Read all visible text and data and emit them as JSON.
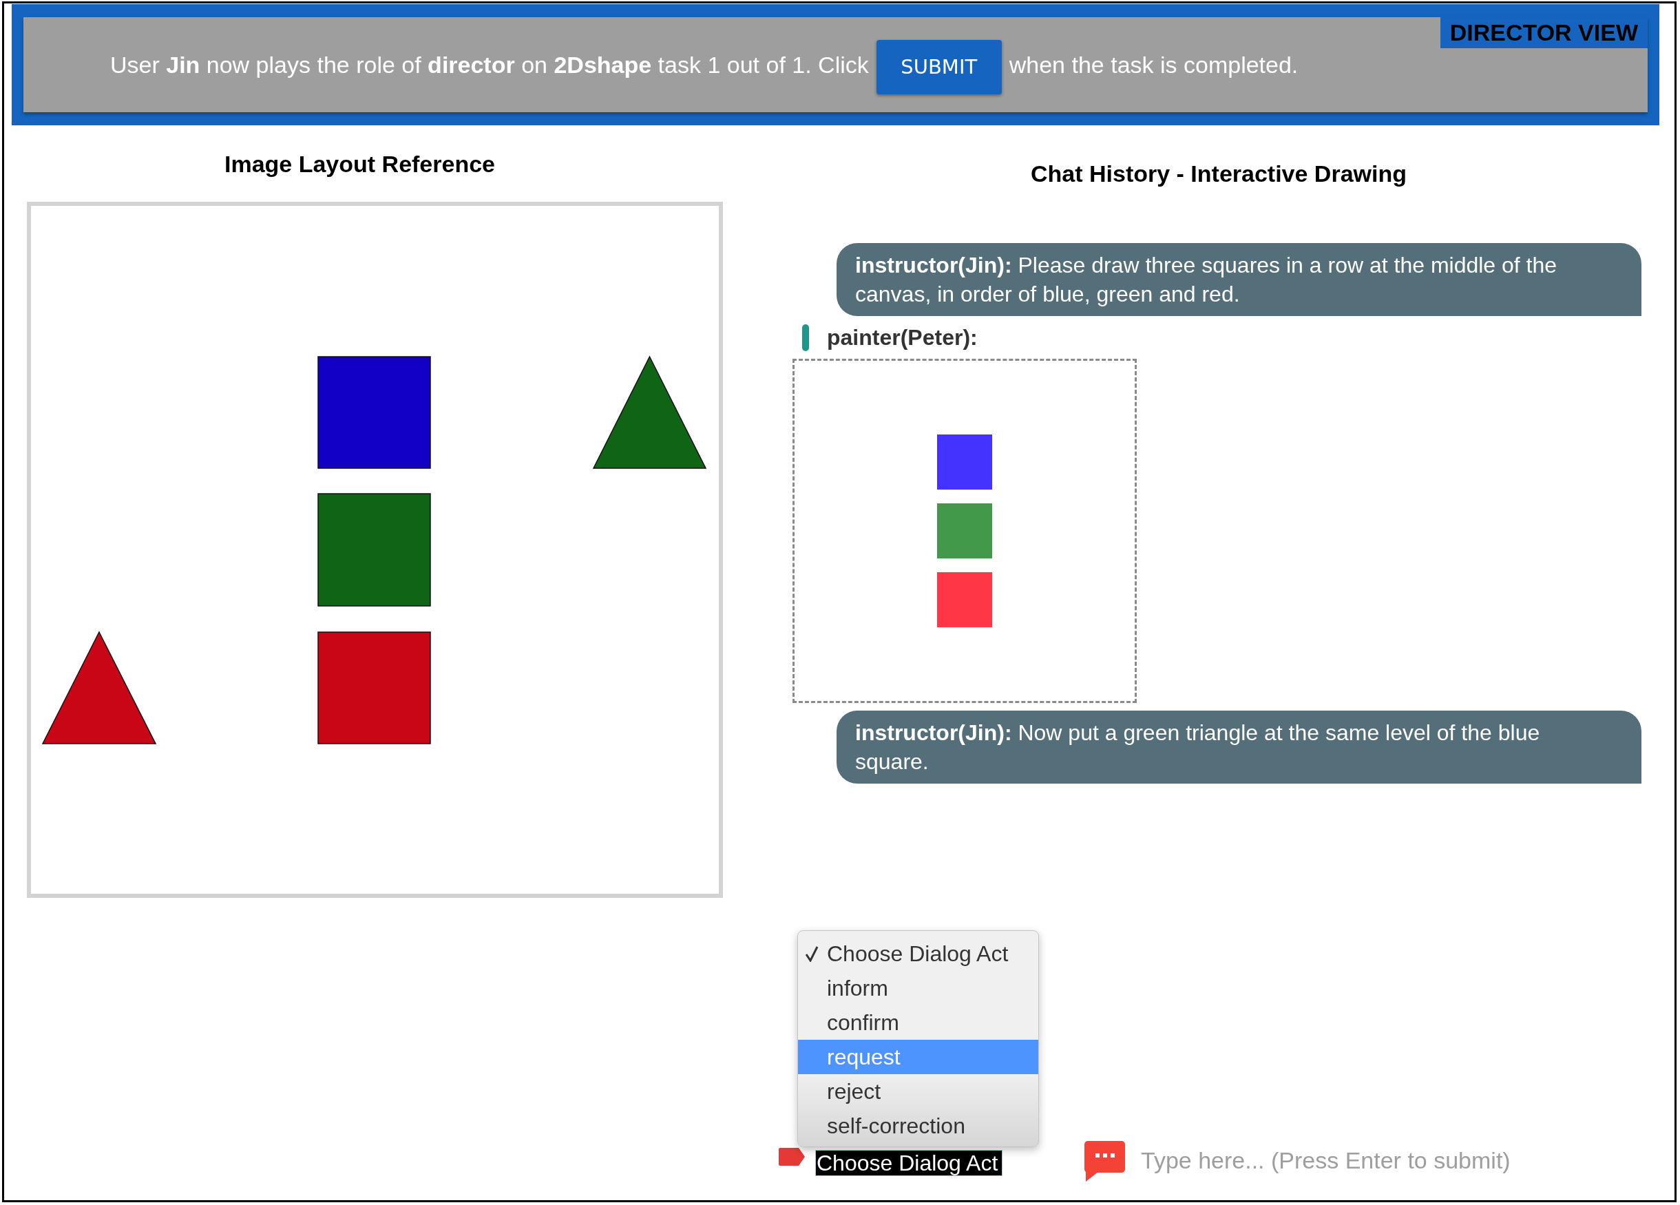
{
  "header": {
    "message": "User **Jin** now plays the role of **director** on **2Dshape** task 1 out of 1. Click",
    "submit_button": "SUBMIT",
    "message_end": "when the task is completed.",
    "badge": "DIRECTOR VIEW"
  },
  "reference_panel": {
    "title": "Image Layout Reference"
  },
  "chat_panel": {
    "title": "Chat History - Interactive Drawing",
    "messages": [
      {
        "kind": "text",
        "text": "**instructor(Jin):** Please draw three squares in a row at the middle of the canvas, in order of blue, green and red."
      },
      {
        "kind": "drawing",
        "speaker": "painter(Peter):"
      },
      {
        "kind": "text",
        "text": "**instructor(Jin):** Now put a green triangle at the same level of the blue square."
      }
    ]
  },
  "dialog_act_menu": {
    "options": [
      {
        "label": "Choose Dialog Act",
        "checked": true,
        "selected": false
      },
      {
        "label": "inform",
        "checked": false,
        "selected": false
      },
      {
        "label": "confirm",
        "checked": false,
        "selected": false
      },
      {
        "label": "request",
        "checked": false,
        "selected": true
      },
      {
        "label": "reject",
        "checked": false,
        "selected": false
      },
      {
        "label": "self-correction",
        "checked": false,
        "selected": false
      }
    ]
  },
  "dialog_act_select": {
    "value": "Choose Dialog Act"
  },
  "message_input": {
    "placeholder": "Type here... (Press Enter to submit)"
  }
}
